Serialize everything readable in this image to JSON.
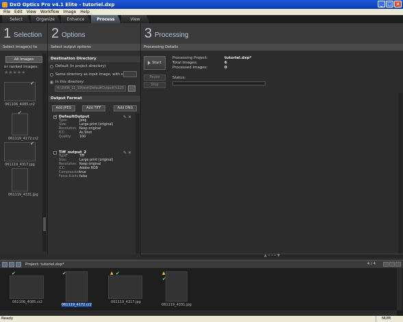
{
  "window": {
    "title": "DxO Optics Pro v4.1 Elite - tutoriel.dxp"
  },
  "menu": [
    "File",
    "Edit",
    "View",
    "Workflow",
    "Image",
    "Help"
  ],
  "tabs": [
    {
      "label": "Select"
    },
    {
      "label": "Organize"
    },
    {
      "label": "Enhance"
    },
    {
      "label": "Process",
      "active": true
    },
    {
      "label": "View"
    }
  ],
  "panels": {
    "selection": {
      "num": "1",
      "title": "Selection",
      "sub": "Select image(s) to process"
    },
    "options": {
      "num": "2",
      "title": "Options",
      "sub": "Select output options"
    },
    "processing": {
      "num": "3",
      "title": "Processing",
      "sub": "Processing Details"
    }
  },
  "selection": {
    "all_images": "All Images",
    "ranked_label": "or ranked images:",
    "stars": "★★★★★",
    "thumbs": [
      {
        "name": "061106_4085.cr2",
        "style": "sunset"
      },
      {
        "name": "061119_4172.cr2",
        "style": "night"
      },
      {
        "name": "061119_4317.jpg",
        "style": "lake"
      },
      {
        "name": "061119_4331.jpg",
        "style": "lake2"
      }
    ]
  },
  "destination": {
    "title": "Destination Directory",
    "default": "Default (in project directory)",
    "same_dir": "Same directory as input image, with suffix:",
    "in_dir": "In this directory:",
    "dir_path": "H:\\2006_11_19\\test\\DefaultOutput\\%125"
  },
  "output_format": {
    "title": "Output Format",
    "add_jpeg": "Add JPEG",
    "add_tiff": "Add TIFF",
    "add_dng": "Add DNG",
    "outputs": [
      {
        "name": "DefaultOutput",
        "rows": [
          {
            "k": "Type:",
            "v": "Jpeg"
          },
          {
            "k": "Size:",
            "v": "Large print (original)"
          },
          {
            "k": "Resolution:",
            "v": "Keep original"
          },
          {
            "k": "ICC:",
            "v": "As Shot"
          },
          {
            "k": "Quality:",
            "v": "100"
          }
        ]
      },
      {
        "name": "Tiff_output_2",
        "rows": [
          {
            "k": "Type:",
            "v": "Tiff"
          },
          {
            "k": "Size:",
            "v": "Large print (original)"
          },
          {
            "k": "Resolution:",
            "v": "Keep original"
          },
          {
            "k": "ICC:",
            "v": "Adobe RGB"
          },
          {
            "k": "Compression:",
            "v": "true"
          },
          {
            "k": "Force 8-bits:",
            "v": "false"
          }
        ]
      }
    ]
  },
  "processing": {
    "start": "Start",
    "pause": "Pause",
    "stop": "Stop",
    "project_label": "Processing Project:",
    "project_value": "tutoriel.dxp*",
    "total_label": "Total Images:",
    "total_value": "6",
    "processed_label": "Processed Images:",
    "processed_value": "0",
    "status_label": "Status:"
  },
  "filmstrip": {
    "project_label": "Project:",
    "project_name": "tutoriel.dxp*",
    "count": "4 / 4",
    "items": [
      {
        "name": "061106_4085.cr2",
        "style": "sunset"
      },
      {
        "name": "061119_4172.cr2",
        "style": "night",
        "selected": true
      },
      {
        "name": "061119_4317.jpg",
        "style": "lake"
      },
      {
        "name": "061119_4331.jpg",
        "style": "lake2"
      }
    ]
  },
  "status": {
    "left": "Ready",
    "num": "NUM"
  }
}
